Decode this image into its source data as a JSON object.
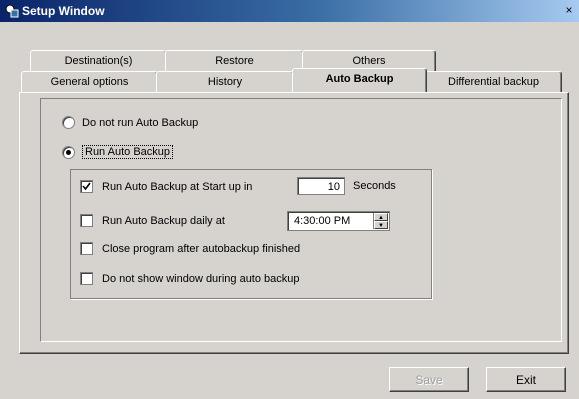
{
  "window": {
    "title": "Setup Window",
    "close_glyph": "×"
  },
  "tabs_back_row": [
    {
      "label": "Destination(s)"
    },
    {
      "label": "Restore"
    },
    {
      "label": "Others"
    }
  ],
  "tabs_front_row": [
    {
      "label": "General options"
    },
    {
      "label": "History"
    },
    {
      "label": "Auto Backup",
      "active": true
    },
    {
      "label": "Differential backup"
    }
  ],
  "auto_backup": {
    "radio_do_not_run": "Do not run Auto Backup",
    "radio_run": "Run Auto Backup",
    "selected_radio": "run",
    "startup_check_label": "Run Auto Backup at Start up in",
    "startup_checked": true,
    "startup_seconds_value": "10",
    "seconds_label": "Seconds",
    "daily_check_label": "Run Auto Backup daily at",
    "daily_checked": false,
    "daily_time_value": "4:30:00 PM",
    "close_program_label": "Close program after autobackup finished",
    "close_program_checked": false,
    "hide_window_label": "Do not show window during auto backup",
    "hide_window_checked": false
  },
  "buttons": {
    "save": "Save",
    "exit": "Exit"
  },
  "icons": {
    "app": "app-icon",
    "close": "close-icon",
    "spin_up": "spin-up-icon",
    "spin_down": "spin-down-icon",
    "check": "checkmark-icon"
  }
}
